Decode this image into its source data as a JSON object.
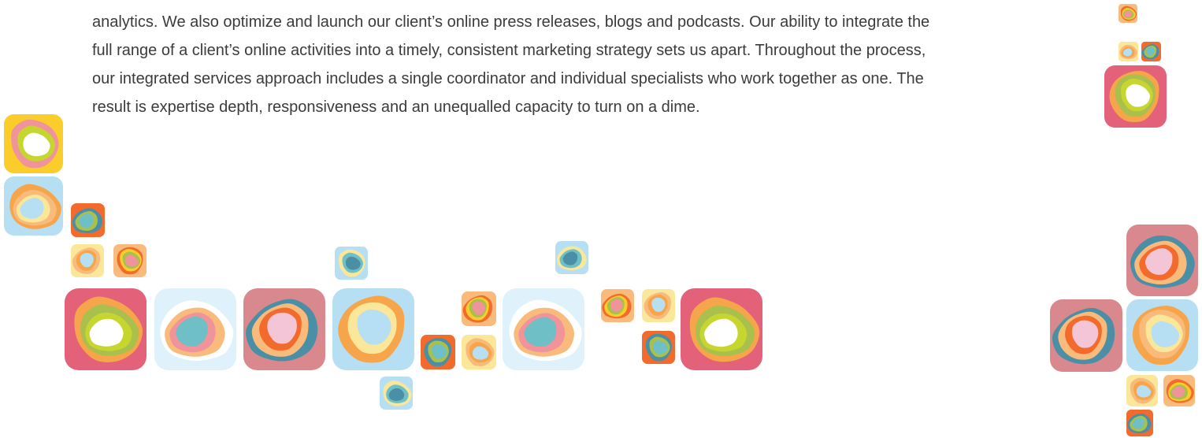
{
  "body_text": {
    "lines": [
      "analytics. We also optimize and launch our client’s online press releases, blogs and podcasts. Our ability to integrate the",
      "full range of a client’s online activities into a timely, consistent marketing strategy sets us apart. Throughout the process,",
      "our integrated services approach includes a single coordinator and individual specialists who work together as one. The",
      "result is expertise depth, responsiveness and an unequalled capacity to turn on a dime."
    ]
  },
  "decoration": {
    "icon": "abstract-ring-tile-icon",
    "palette": {
      "pink": "#e4617a",
      "rose": "#d9888d",
      "light_blue": "#b6dff3",
      "pale_blue": "#dff1fb",
      "yellow": "#fbcd2a",
      "pale_yellow": "#fbe79a",
      "orange": "#f26b2c",
      "light_orange": "#f6a54a",
      "peach": "#f9bb7c",
      "salmon": "#f0939a",
      "olive": "#a9c04c",
      "lime": "#c6d52f",
      "teal": "#6fbfc7",
      "steel_teal": "#4a8fa6",
      "pale_pink": "#f4c4d7",
      "white": "#ffffff"
    }
  }
}
